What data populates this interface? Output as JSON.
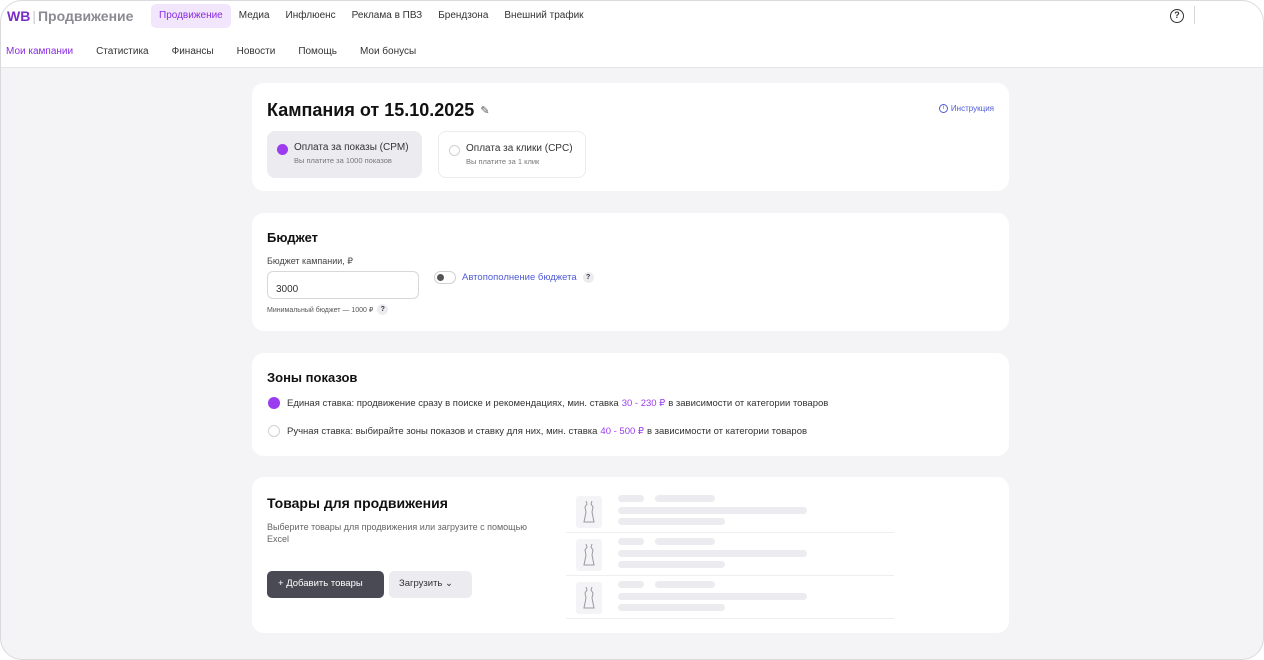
{
  "header": {
    "logo_brand": "WB",
    "logo_product": "Продвижение",
    "top_nav": [
      "Продвижение",
      "Медиа",
      "Инфлюенс",
      "Реклама в ПВЗ",
      "Брендзона",
      "Внешний трафик"
    ],
    "help_icon": "question-circle-icon",
    "sub_nav": [
      "Мои кампании",
      "Статистика",
      "Финансы",
      "Новости",
      "Помощь",
      "Мои бонусы"
    ]
  },
  "campaign": {
    "title": "Кампания от 15.10.2025",
    "instruction": "Инструкция",
    "payment": {
      "cpm_title": "Оплата за показы (CPM)",
      "cpm_desc": "Вы платите за 1000 показов",
      "cpc_title": "Оплата за клики (CPC)",
      "cpc_desc": "Вы платите за 1 клик",
      "selected": "cpm"
    }
  },
  "budget": {
    "title": "Бюджет",
    "label": "Бюджет кампании, ₽",
    "value": "3000",
    "min_note": "Минимальный бюджет — 1000 ₽",
    "autofill": "Автопополнение бюджета",
    "autofill_enabled": false
  },
  "zones": {
    "title": "Зоны показов",
    "single": {
      "text": "Единая ставка: продвижение сразу в поиске и рекомендациях, мин. ставка",
      "range": "30 - 230 ₽",
      "suffix": "в зависимости от категории товаров"
    },
    "manual": {
      "text": "Ручная ставка: выбирайте зоны показов и ставку для них, мин. ставка",
      "range": "40 - 500 ₽",
      "suffix": "в зависимости от категории товаров"
    },
    "selected": "single"
  },
  "goods": {
    "title": "Товары для продвижения",
    "desc": "Выберите товары для продвижения или загрузите с помощью Excel",
    "add_button": "Добавить товары",
    "load_button": "Загрузить"
  },
  "colors": {
    "accent": "#8a2be2",
    "radio": "#9b3cf0",
    "link": "#4f5bd5",
    "dark_button": "#4a4a55"
  }
}
